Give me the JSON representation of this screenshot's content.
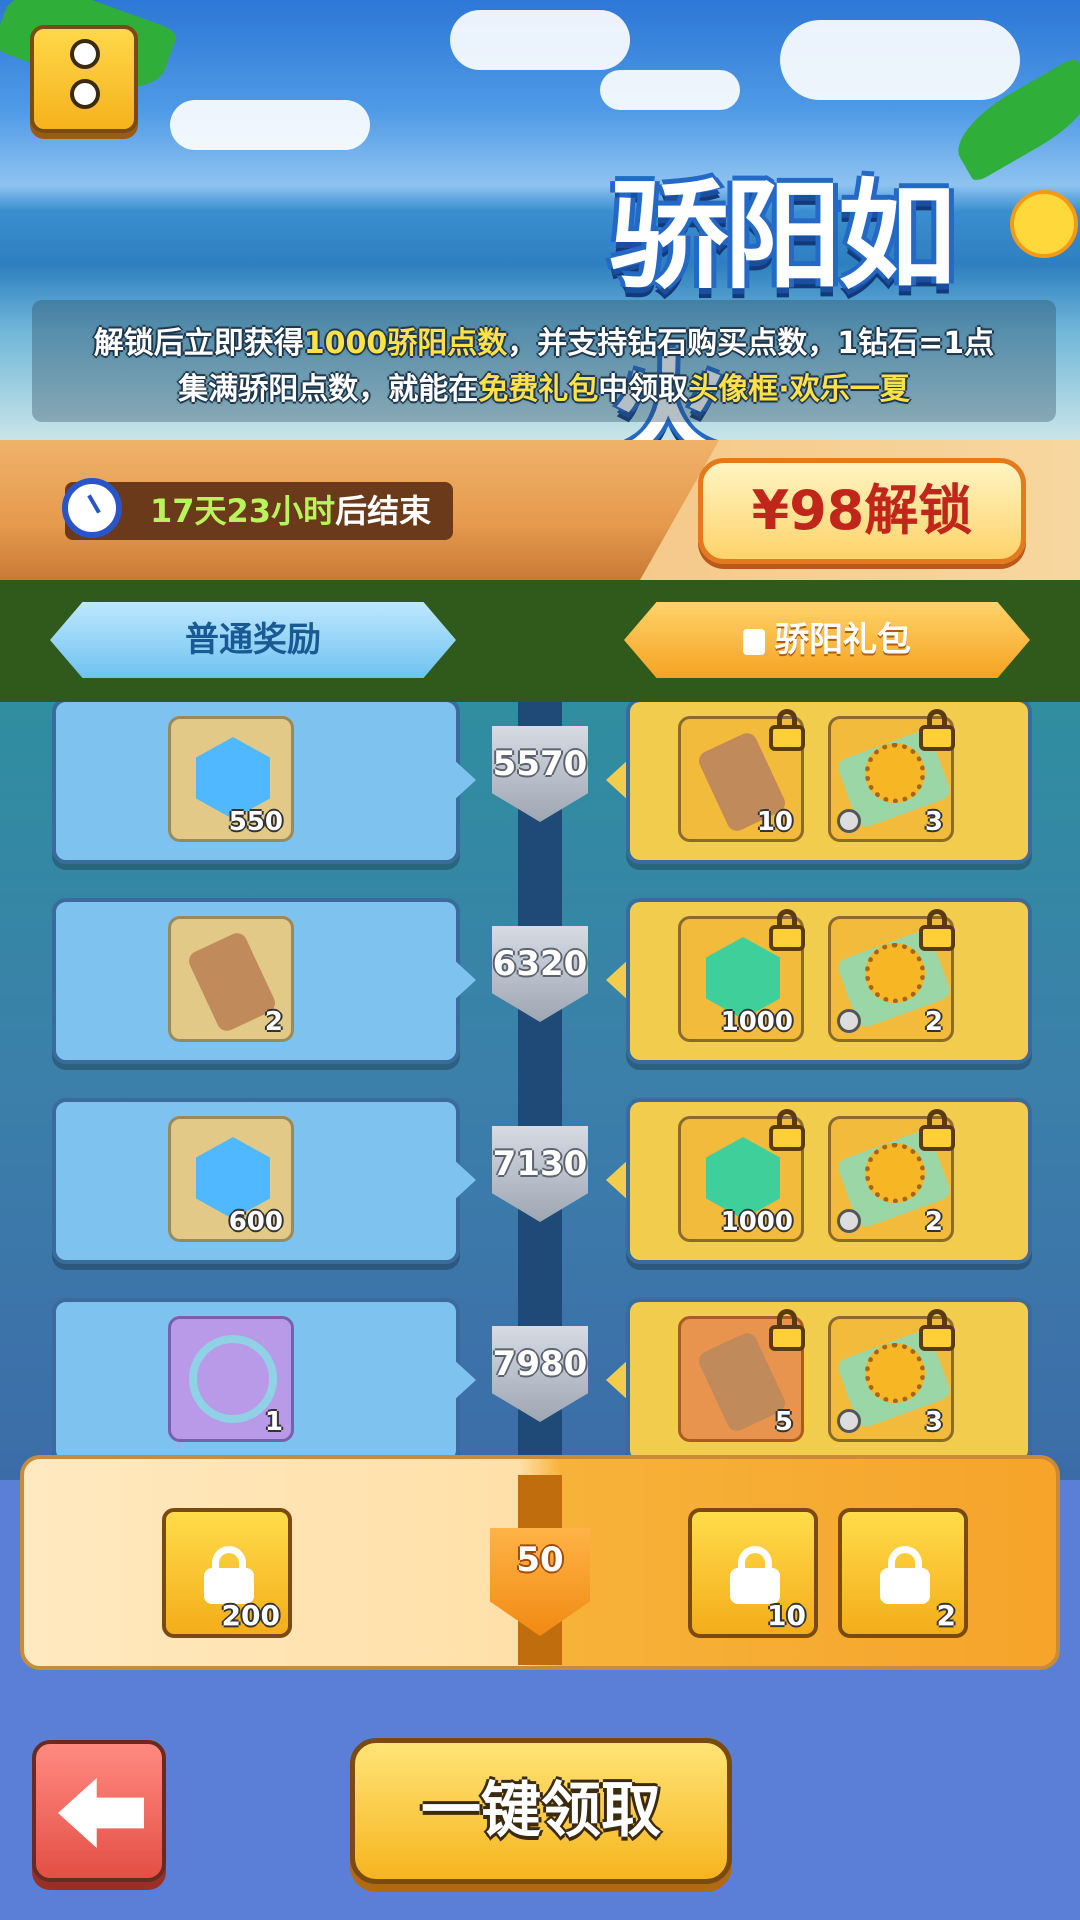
{
  "banner": {
    "title": "骄阳如火",
    "desc_line1_parts": [
      "解锁后立即获得",
      "1000骄阳点数",
      "，并支持钻石购买点数，1钻石=1点"
    ],
    "desc_line2_parts": [
      "集满骄阳点数，就能在",
      "免费礼包",
      "中领取",
      "头像框·欢乐一夏"
    ]
  },
  "timer": {
    "countdown": "17天23小时",
    "suffix": "后结束"
  },
  "unlock_button": {
    "label": "¥98解锁"
  },
  "tabs": {
    "normal": "普通奖励",
    "premium": "骄阳礼包"
  },
  "rows": [
    {
      "level": "5570",
      "free": {
        "icon": "blue-gem-icon",
        "qty": "550"
      },
      "premium": [
        {
          "icon": "scroll-icon",
          "qty": "10"
        },
        {
          "icon": "sunflower-ticket-icon",
          "qty": "3"
        }
      ]
    },
    {
      "level": "6320",
      "free": {
        "icon": "scroll-icon",
        "qty": "2"
      },
      "premium": [
        {
          "icon": "green-gem-icon",
          "qty": "1000"
        },
        {
          "icon": "sunflower-ticket-icon",
          "qty": "2"
        }
      ]
    },
    {
      "level": "7130",
      "free": {
        "icon": "blue-gem-icon",
        "qty": "600"
      },
      "premium": [
        {
          "icon": "green-gem-icon",
          "qty": "1000"
        },
        {
          "icon": "sunflower-ticket-icon",
          "qty": "2"
        }
      ]
    },
    {
      "level": "7980",
      "free": {
        "icon": "avatar-frame-icon",
        "qty": "1"
      },
      "premium": [
        {
          "icon": "orange-scroll-icon",
          "qty": "5"
        },
        {
          "icon": "sunflower-ticket-icon",
          "qty": "3"
        }
      ]
    }
  ],
  "final_reward": {
    "level": "50",
    "free": {
      "icon": "locked-gem-icon",
      "qty": "200"
    },
    "premium": [
      {
        "icon": "locked-scroll-icon",
        "qty": "10"
      },
      {
        "icon": "locked-ticket-icon",
        "qty": "2"
      }
    ]
  },
  "bottom": {
    "claim_all": "一键领取"
  }
}
